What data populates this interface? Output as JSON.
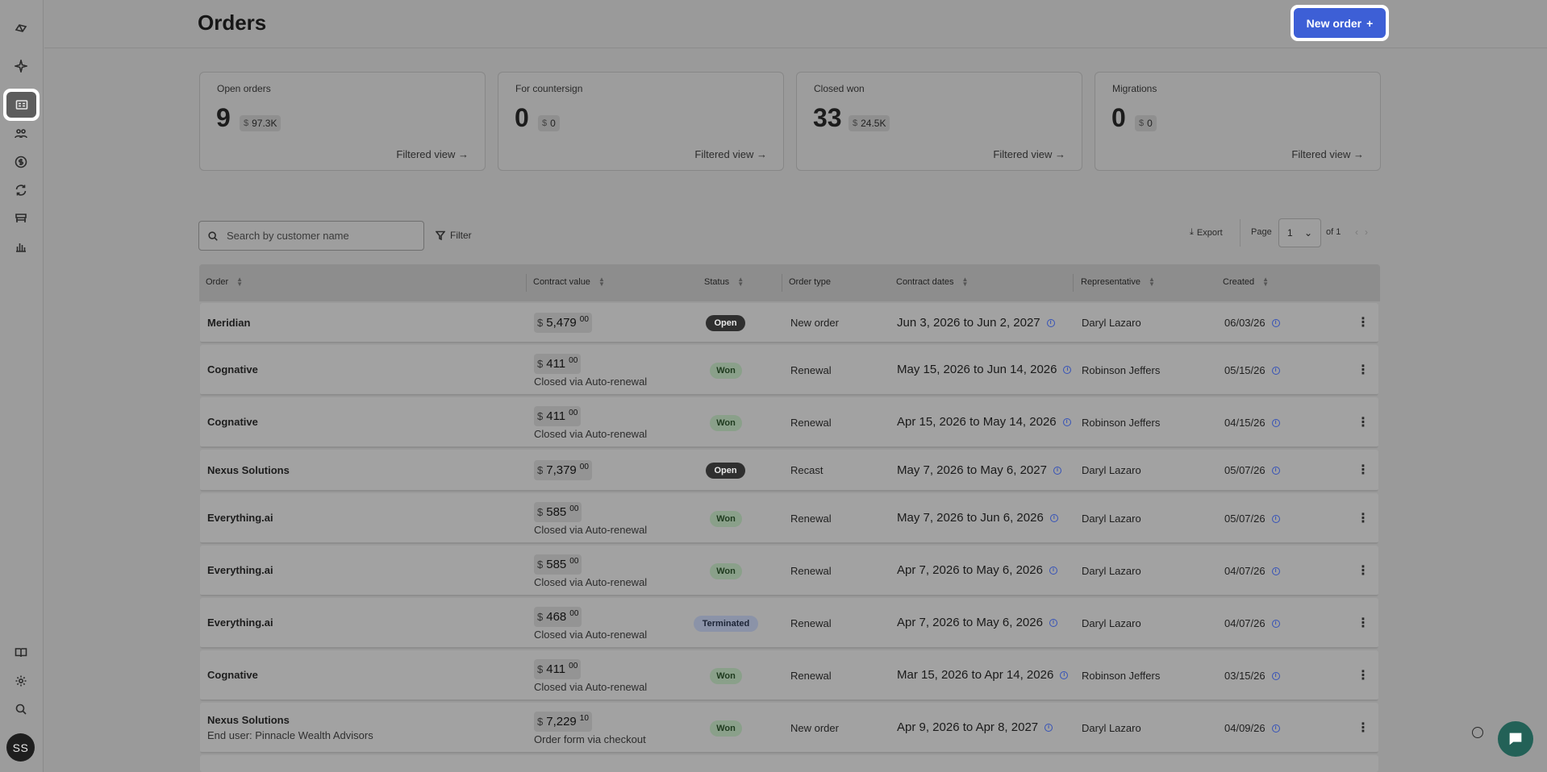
{
  "header": {
    "title": "Orders",
    "new_order_label": "New order",
    "new_order_icon": "+"
  },
  "sidebar": {
    "items": [
      {
        "name": "logo-icon"
      },
      {
        "name": "sparkle-icon"
      },
      {
        "name": "orders-icon",
        "active": true
      },
      {
        "name": "customers-icon"
      },
      {
        "name": "billing-icon"
      },
      {
        "name": "renewals-icon"
      },
      {
        "name": "products-icon"
      },
      {
        "name": "reports-icon"
      },
      {
        "name": "book-icon"
      },
      {
        "name": "gear-icon"
      },
      {
        "name": "search-icon"
      }
    ],
    "avatar": "SS"
  },
  "cards": [
    {
      "label": "Open orders",
      "count": "9",
      "currency": "$",
      "amount": "97.3K",
      "link": "Filtered view →"
    },
    {
      "label": "For countersign",
      "count": "0",
      "currency": "$",
      "amount": "0",
      "link": "Filtered view →"
    },
    {
      "label": "Closed won",
      "count": "33",
      "currency": "$",
      "amount": "24.5K",
      "link": "Filtered view →"
    },
    {
      "label": "Migrations",
      "count": "0",
      "currency": "$",
      "amount": "0",
      "link": "Filtered view →"
    }
  ],
  "toolbar": {
    "search_placeholder": "Search by customer name",
    "filter_label": "Filter",
    "export_label": "Export",
    "page_label": "Page",
    "page_value": "1",
    "page_of": "of 1"
  },
  "table": {
    "columns": [
      "Order",
      "Contract value",
      "Status",
      "Order type",
      "Contract dates",
      "Representative",
      "Created"
    ],
    "rows": [
      {
        "order": "Meridian",
        "sub": "",
        "currency": "$",
        "value": "5,479",
        "cents": "00",
        "note": "",
        "status": "Open",
        "status_kind": "open",
        "type": "New order",
        "dates": "Jun 3, 2026 to Jun 2, 2027",
        "rep": "Daryl Lazaro",
        "created": "06/03/26"
      },
      {
        "order": "Cognative",
        "sub": "",
        "currency": "$",
        "value": "411",
        "cents": "00",
        "note": "Closed via Auto-renewal",
        "status": "Won",
        "status_kind": "won",
        "type": "Renewal",
        "dates": "May 15, 2026 to Jun 14, 2026",
        "rep": "Robinson Jeffers",
        "created": "05/15/26"
      },
      {
        "order": "Cognative",
        "sub": "",
        "currency": "$",
        "value": "411",
        "cents": "00",
        "note": "Closed via Auto-renewal",
        "status": "Won",
        "status_kind": "won",
        "type": "Renewal",
        "dates": "Apr 15, 2026 to May 14, 2026",
        "rep": "Robinson Jeffers",
        "created": "04/15/26"
      },
      {
        "order": "Nexus Solutions",
        "sub": "",
        "currency": "$",
        "value": "7,379",
        "cents": "00",
        "note": "",
        "status": "Open",
        "status_kind": "open",
        "type": "Recast",
        "dates": "May 7, 2026 to May 6, 2027",
        "rep": "Daryl Lazaro",
        "created": "05/07/26"
      },
      {
        "order": "Everything.ai",
        "sub": "",
        "currency": "$",
        "value": "585",
        "cents": "00",
        "note": "Closed via Auto-renewal",
        "status": "Won",
        "status_kind": "won",
        "type": "Renewal",
        "dates": "May 7, 2026 to Jun 6, 2026",
        "rep": "Daryl Lazaro",
        "created": "05/07/26"
      },
      {
        "order": "Everything.ai",
        "sub": "",
        "currency": "$",
        "value": "585",
        "cents": "00",
        "note": "Closed via Auto-renewal",
        "status": "Won",
        "status_kind": "won",
        "type": "Renewal",
        "dates": "Apr 7, 2026 to May 6, 2026",
        "rep": "Daryl Lazaro",
        "created": "04/07/26"
      },
      {
        "order": "Everything.ai",
        "sub": "",
        "currency": "$",
        "value": "468",
        "cents": "00",
        "note": "Closed via Auto-renewal",
        "status": "Terminated",
        "status_kind": "terminated",
        "type": "Renewal",
        "dates": "Apr 7, 2026 to May 6, 2026",
        "rep": "Daryl Lazaro",
        "created": "04/07/26"
      },
      {
        "order": "Cognative",
        "sub": "",
        "currency": "$",
        "value": "411",
        "cents": "00",
        "note": "Closed via Auto-renewal",
        "status": "Won",
        "status_kind": "won",
        "type": "Renewal",
        "dates": "Mar 15, 2026 to Apr 14, 2026",
        "rep": "Robinson Jeffers",
        "created": "03/15/26"
      },
      {
        "order": "Nexus Solutions",
        "sub": "End user: Pinnacle Wealth Advisors",
        "currency": "$",
        "value": "7,229",
        "cents": "10",
        "note": "Order form via checkout",
        "status": "Won",
        "status_kind": "won",
        "type": "New order",
        "dates": "Apr 9, 2026 to Apr 8, 2027",
        "rep": "Daryl Lazaro",
        "created": "04/09/26"
      }
    ]
  }
}
